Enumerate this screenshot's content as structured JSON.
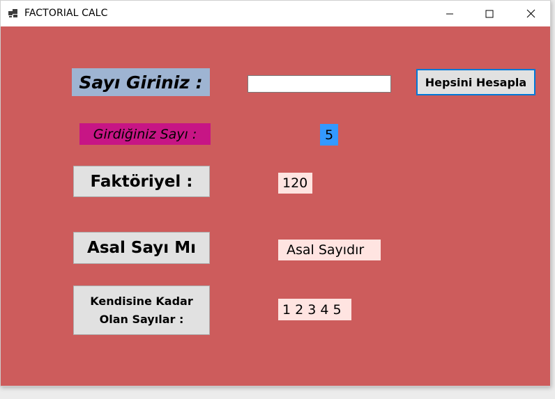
{
  "window": {
    "title": "FACTORIAL CALC",
    "app_icon": "app-windows-icon",
    "controls": [
      "minimize-icon",
      "maximize-icon",
      "close-icon"
    ]
  },
  "form": {
    "input_label": "Sayı Giriniz :",
    "number_input": {
      "value": "",
      "placeholder": ""
    },
    "calculate_button": "Hepsini Hesapla",
    "entered_label": "Girdiğiniz Sayı :",
    "entered_value": "5",
    "factorial_label": "Faktöriyel :",
    "factorial_value": "120",
    "prime_label": "Asal Sayı Mı",
    "prime_value": "Asal Sayıdır",
    "sequence_label_line1": "Kendisine Kadar",
    "sequence_label_line2": "Olan Sayılar :",
    "sequence_value": "1 2 3 4 5"
  },
  "colors": {
    "client_background": "#cd5c5c",
    "input_label_bg": "#9eb4d2",
    "entered_label_bg": "#c71585",
    "entered_value_bg": "#3399ff",
    "output_bg": "#ffe4e1",
    "button_bg": "#e1e1e1",
    "button_focus_border": "#0078d7"
  }
}
